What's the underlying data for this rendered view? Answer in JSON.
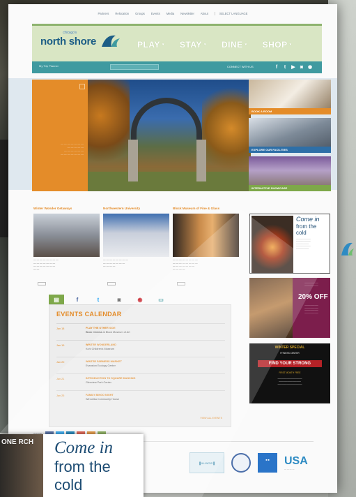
{
  "topnav": {
    "items": [
      "Partners",
      "Relocation",
      "Groups",
      "Events",
      "Media",
      "Newsletter",
      "About"
    ],
    "select_label": "SELECT LANGUAGE"
  },
  "brand": {
    "name": "north shore",
    "tagline": "chicago's"
  },
  "mainnav": [
    "PLAY",
    "STAY",
    "DINE",
    "SHOP"
  ],
  "tealbar": {
    "planner": "My Trip Planner",
    "connect": "CONNECT WITH US"
  },
  "colors": {
    "orange": "#e48c29",
    "teal": "#3f9aa0",
    "green": "#8eb36f",
    "navy": "#1c5d86"
  },
  "sidecards": [
    {
      "label": "BOOK A ROOM",
      "color": "#e48c29"
    },
    {
      "label": "EXPLORE OUR FACILITIES",
      "color": "#2e6fa7"
    },
    {
      "label": "INTERACTIVE SHOWCASE",
      "color": "#7ea84a"
    }
  ],
  "columns": [
    {
      "title": "Winter Wonder Getaways"
    },
    {
      "title": "Northwestern University"
    },
    {
      "title": "Block Museum of Fine & Glass"
    }
  ],
  "social_tabs": [
    "f",
    "t"
  ],
  "events": {
    "title": "EVENTS CALENDAR",
    "rows": [
      {
        "date": "Jan 18",
        "name": "PLAY THE OTHER SIDE",
        "place": "Block Cinema at Block Museum of Art"
      },
      {
        "date": "Jan 19",
        "name": "WINTER WONDERLAND",
        "place": "Kohl Children's Museum"
      },
      {
        "date": "Jan 20",
        "name": "WINTER FARMERS MARKET",
        "place": "Evanston Ecology Center"
      },
      {
        "date": "Jan 21",
        "name": "INTRODUCTION TO SQUARE DANCING",
        "place": "Glenview Park Center"
      },
      {
        "date": "Jan 25",
        "name": "FAMILY BINGO NIGHT",
        "place": "Winnetka Community House"
      }
    ],
    "view_all": "VIEW ALL EVENTS"
  },
  "ads": {
    "fire": {
      "come": "Come in",
      "from": "from the",
      "cold": "cold"
    },
    "hotel": {
      "pct": "20% OFF"
    },
    "fitness": {
      "head": "WINTER SPECIAL",
      "find": "FIND YOUR STRONG",
      "sub": "FITNESS CENTER",
      "free": "FIRST MONTH FREE"
    }
  },
  "share": {
    "label": "SHARE"
  },
  "footer": {
    "usa": "USA"
  },
  "zoom": {
    "come": "Come in",
    "from": "from the",
    "cold": "cold",
    "side": "ONE RCH"
  }
}
